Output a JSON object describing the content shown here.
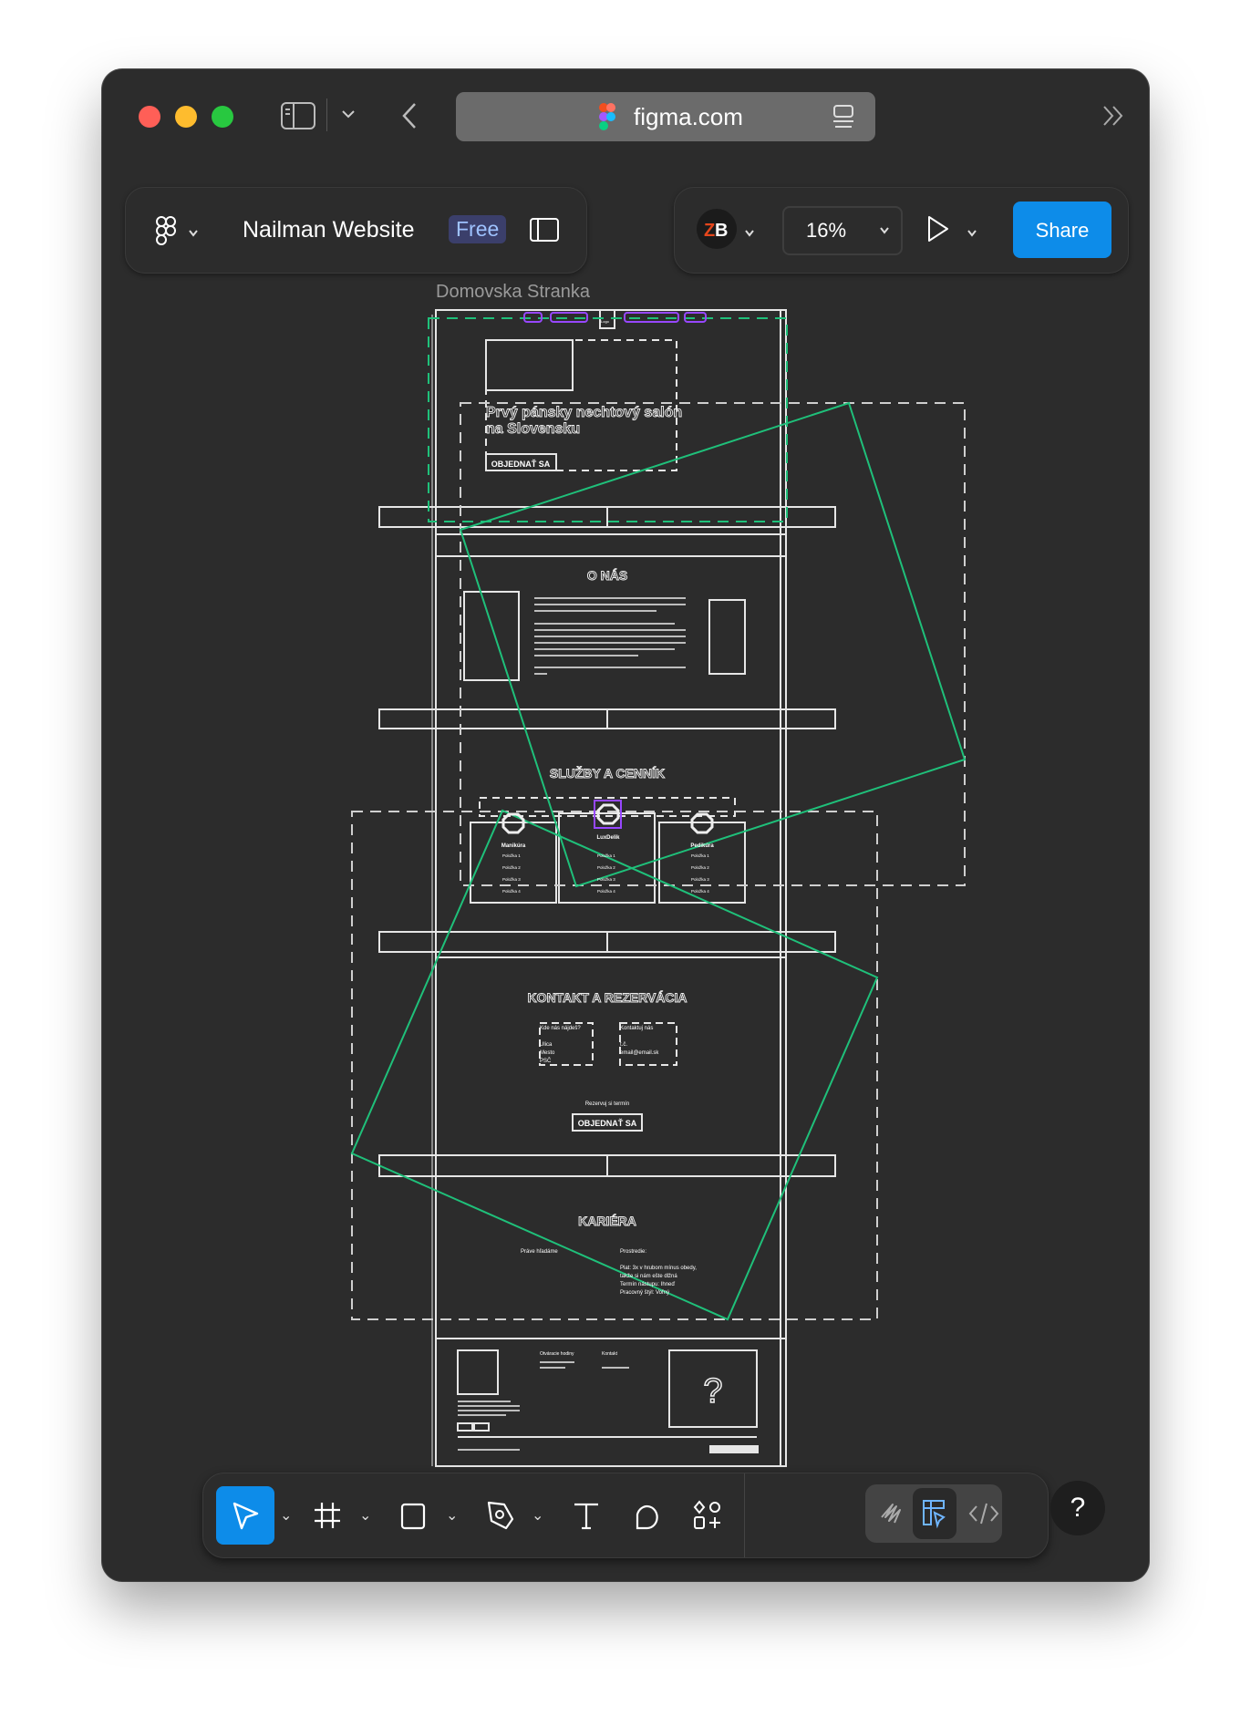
{
  "browser": {
    "url": "figma.com",
    "traffic_lights": {
      "close": "#ff5f57",
      "minimize": "#febc2e",
      "maximize": "#28c840"
    }
  },
  "header": {
    "file_name": "Nailman Website",
    "plan_badge": "Free",
    "zoom_level": "16%",
    "share_label": "Share",
    "share_color": "#0d8ce9"
  },
  "canvas": {
    "frame_label": "Domovska Stranka",
    "selection_color": "#1fc07a",
    "component_color": "#9747ff",
    "nav": {
      "logo": "Logo"
    },
    "hero": {
      "title_line1": "Prvý pánsky nechtový salón",
      "title_line2": "na Slovensku",
      "button": "OBJEDNAŤ SA"
    },
    "about": {
      "heading": "O NÁS"
    },
    "services": {
      "heading": "SLUŽBY A CENNÍK",
      "cards": [
        {
          "name": "Manikúra",
          "items": [
            "Položka 1",
            "Položka 2",
            "Položka 3",
            "Položka 4"
          ]
        },
        {
          "name": "LuxDelik",
          "items": [
            "Položka 1",
            "Položka 2",
            "Položka 3",
            "Položka 4"
          ]
        },
        {
          "name": "Pedikúra",
          "items": [
            "Položka 1",
            "Položka 2",
            "Položka 3",
            "Položka 4"
          ]
        }
      ]
    },
    "contact": {
      "heading": "KONTAKT A REZERVÁCIA",
      "where_title": "Kde nás nájdeš?",
      "street": "Ulica",
      "city": "Mesto",
      "zip": "PSČ",
      "contact_title": "Kontaktuj nás",
      "phone": "t.č.",
      "email": "email@email.sk",
      "reserve_text": "Rezervuj si termín",
      "button": "OBJEDNAŤ SA"
    },
    "career": {
      "heading": "KARIÉRA",
      "seeking": "Práve hľadáme",
      "env_title": "Prostredie:",
      "lines": [
        "Plat: 3x v hrubom mínus obedy,",
        "takže si nám ešte dlžná",
        "Termín nástupu: Ihneď",
        "Pracovný štýl: Voľný"
      ]
    },
    "footer": {
      "hours_title": "Otváracie hodiny",
      "contact_title": "Kontakt",
      "placeholder": "?"
    }
  },
  "toolbar": {
    "tools": [
      "move",
      "frame",
      "rectangle",
      "pen",
      "text",
      "comment",
      "assets"
    ],
    "active_tool": "move",
    "modes": [
      "draw",
      "design",
      "dev"
    ],
    "active_mode": "design",
    "help": "?"
  }
}
